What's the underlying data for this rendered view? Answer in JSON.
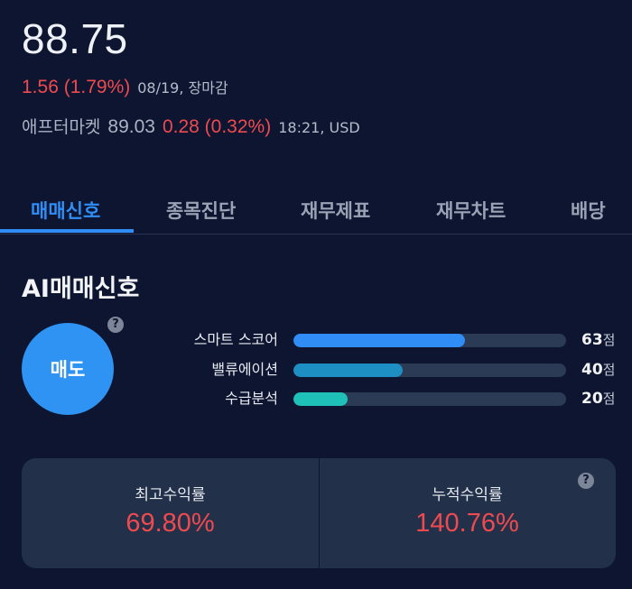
{
  "quote": {
    "price": "88.75",
    "change": "1.56 (1.79%)",
    "change_meta": "08/19, 장마감",
    "after_label": "애프터마켓",
    "after_price": "89.03",
    "after_change": "0.28 (0.32%)",
    "after_meta": "18:21, USD"
  },
  "tabs": [
    {
      "label": "매매신호",
      "active": true
    },
    {
      "label": "종목진단",
      "active": false
    },
    {
      "label": "재무제표",
      "active": false
    },
    {
      "label": "재무차트",
      "active": false
    },
    {
      "label": "배당",
      "active": false
    }
  ],
  "signal": {
    "title": "AI매매신호",
    "action": "매도",
    "help_icon": "?",
    "scores": [
      {
        "label": "스마트 스코어",
        "value": "63",
        "unit": "점",
        "fraction": 0.63,
        "color": "#2f8df5"
      },
      {
        "label": "밸류에이션",
        "value": "40",
        "unit": "점",
        "fraction": 0.4,
        "color": "#1e8fc2"
      },
      {
        "label": "수급분석",
        "value": "20",
        "unit": "점",
        "fraction": 0.2,
        "color": "#1fc0b8"
      }
    ]
  },
  "returns": {
    "max_label": "최고수익률",
    "max_value": "69.80%",
    "cum_label": "누적수익률",
    "cum_value": "140.76%",
    "help_icon": "?"
  },
  "colors": {
    "background": "#0e1530",
    "accent": "#2f8df5",
    "up_red": "#ef4a4f",
    "card": "#223149"
  }
}
